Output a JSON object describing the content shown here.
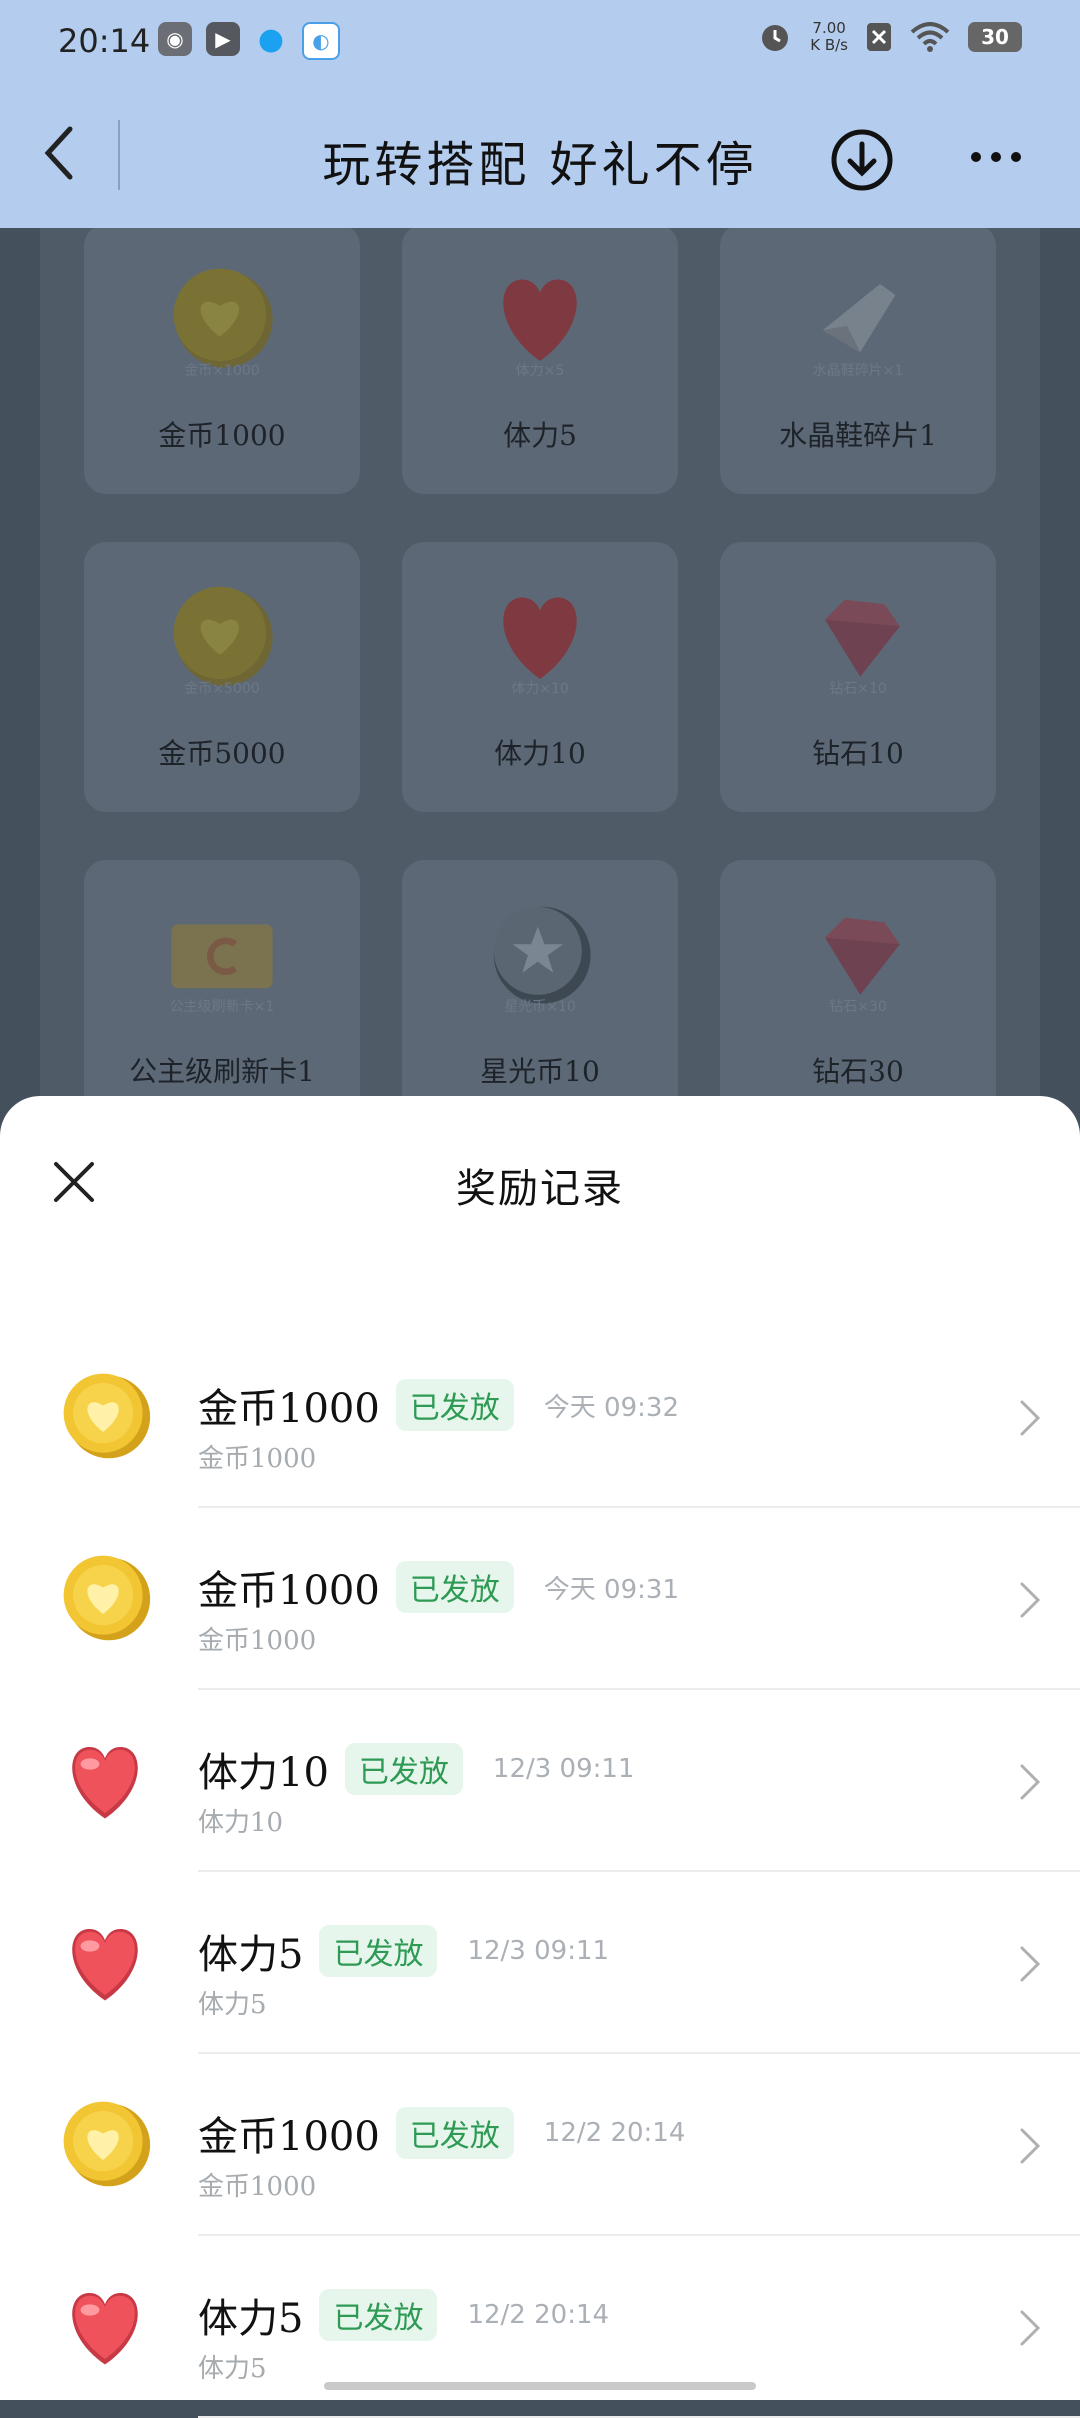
{
  "status": {
    "time": "20:14",
    "net_speed": "7.00",
    "net_unit": "K B/s",
    "battery": "30"
  },
  "header": {
    "title": "玩转搭配 好礼不停"
  },
  "grid": [
    {
      "label": "金币1000",
      "sub": "金币×1000",
      "icon": "coin"
    },
    {
      "label": "体力5",
      "sub": "体力×5",
      "icon": "heart"
    },
    {
      "label": "水晶鞋碎片1",
      "sub": "水晶鞋碎片×1",
      "icon": "crystal"
    },
    {
      "label": "金币5000",
      "sub": "金币×5000",
      "icon": "coin"
    },
    {
      "label": "体力10",
      "sub": "体力×10",
      "icon": "heart"
    },
    {
      "label": "钻石10",
      "sub": "钻石×10",
      "icon": "diamond"
    },
    {
      "label": "公主级刷新卡1",
      "sub": "公主级刷新卡×1",
      "icon": "card"
    },
    {
      "label": "星光币10",
      "sub": "星光币×10",
      "icon": "star-coin"
    },
    {
      "label": "钻石30",
      "sub": "钻石×30",
      "icon": "diamond"
    }
  ],
  "sheet": {
    "title": "奖励记录",
    "records": [
      {
        "name": "金币1000",
        "badge": "已发放",
        "time": "今天 09:32",
        "sub": "金币1000",
        "icon": "coin"
      },
      {
        "name": "金币1000",
        "badge": "已发放",
        "time": "今天 09:31",
        "sub": "金币1000",
        "icon": "coin"
      },
      {
        "name": "体力10",
        "badge": "已发放",
        "time": "12/3 09:11",
        "sub": "体力10",
        "icon": "heart"
      },
      {
        "name": "体力5",
        "badge": "已发放",
        "time": "12/3 09:11",
        "sub": "体力5",
        "icon": "heart"
      },
      {
        "name": "金币1000",
        "badge": "已发放",
        "time": "12/2 20:14",
        "sub": "金币1000",
        "icon": "coin"
      },
      {
        "name": "体力5",
        "badge": "已发放",
        "time": "12/2 20:14",
        "sub": "体力5",
        "icon": "heart"
      }
    ]
  }
}
